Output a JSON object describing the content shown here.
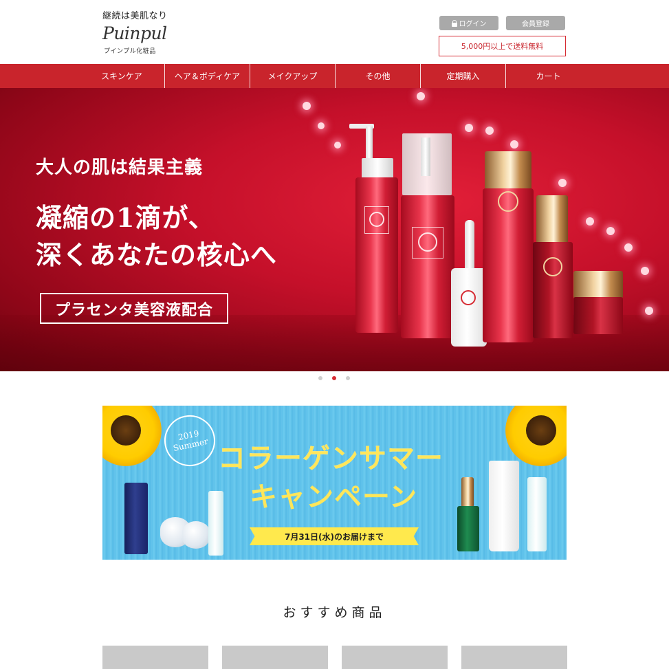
{
  "header": {
    "tagline": "継続は美肌なり",
    "logo_text": "Puinpul",
    "logo_sub": "プインプル化粧品",
    "login_label": "ログイン",
    "register_label": "会員登録",
    "shipping_notice": "5,000円以上で送料無料"
  },
  "nav": {
    "items": [
      {
        "label": "スキンケア"
      },
      {
        "label": "ヘア＆ボディケア"
      },
      {
        "label": "メイクアップ"
      },
      {
        "label": "その他"
      },
      {
        "label": "定期購入"
      },
      {
        "label": "カート"
      }
    ]
  },
  "hero": {
    "line1": "大人の肌は結果主義",
    "line2": "凝縮の1滴が、",
    "line3": "深くあなたの核心へ",
    "badge": "プラセンタ美容液配合",
    "active_slide": 2,
    "slide_count": 3
  },
  "campaign": {
    "badge_year": "2019",
    "badge_word": "Summer",
    "title_line1": "コラーゲンサマー",
    "title_line2": "キャンペーン",
    "ribbon": "7月31日(水)のお届けまで"
  },
  "recommended": {
    "title": "おすすめ商品",
    "card_count": 4
  },
  "colors": {
    "brand_red": "#c9242c",
    "button_gray": "#a9a9a9",
    "campaign_blue": "#5cc0ea",
    "campaign_yellow": "#ffe65a"
  }
}
